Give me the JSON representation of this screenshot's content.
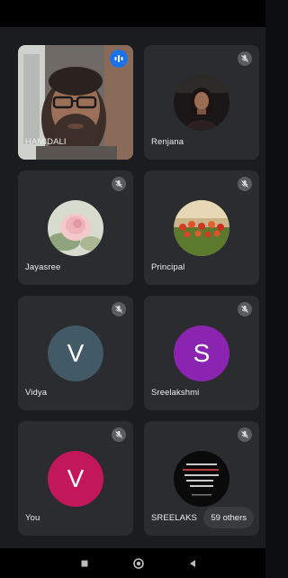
{
  "participants": [
    {
      "name": "HAMIDALI",
      "mic": "active",
      "kind": "video"
    },
    {
      "name": "Renjana",
      "mic": "muted",
      "kind": "photo",
      "photo": "portrait"
    },
    {
      "name": "Jayasree",
      "mic": "muted",
      "kind": "photo",
      "photo": "pink-flower"
    },
    {
      "name": "Principal",
      "mic": "muted",
      "kind": "photo",
      "photo": "red-flowers"
    },
    {
      "name": "Vidya",
      "mic": "muted",
      "kind": "letter",
      "letter": "V",
      "color": "#425a66"
    },
    {
      "name": "Sreelakshmi",
      "mic": "muted",
      "kind": "letter",
      "letter": "S",
      "color": "#8b24b0"
    },
    {
      "name": "You",
      "mic": "muted",
      "kind": "letter",
      "letter": "V",
      "color": "#c2185b"
    },
    {
      "name": "SREELAKS",
      "mic": "muted",
      "kind": "photo",
      "photo": "quote-card"
    }
  ],
  "others_badge": "59 others",
  "colors": {
    "accent_blue": "#1a73e8",
    "tile_bg": "#2b2c30",
    "app_bg": "#1b1c1f"
  },
  "icons": {
    "mic_muted": "mic-off-icon",
    "mic_active": "audio-level-icon",
    "nav_recents": "square-icon",
    "nav_home": "circle-icon",
    "nav_back": "triangle-back-icon"
  }
}
